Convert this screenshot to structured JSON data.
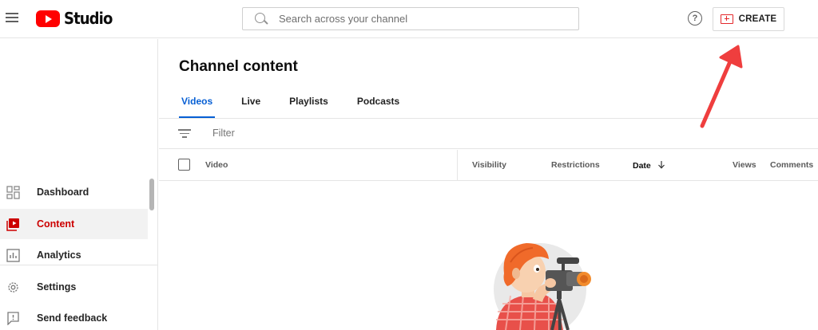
{
  "header": {
    "logo_text": "Studio",
    "search_placeholder": "Search across your channel",
    "create_label": "CREATE",
    "help_glyph": "?"
  },
  "sidebar": {
    "items": [
      {
        "label": "Dashboard",
        "icon": "dashboard-icon"
      },
      {
        "label": "Content",
        "icon": "content-icon",
        "active": true
      },
      {
        "label": "Analytics",
        "icon": "analytics-icon"
      },
      {
        "label": "Settings",
        "icon": "settings-icon"
      },
      {
        "label": "Send feedback",
        "icon": "feedback-icon"
      }
    ]
  },
  "main": {
    "title": "Channel content",
    "tabs": [
      {
        "label": "Videos",
        "active": true
      },
      {
        "label": "Live"
      },
      {
        "label": "Playlists"
      },
      {
        "label": "Podcasts"
      }
    ],
    "filter_placeholder": "Filter",
    "columns": {
      "video": "Video",
      "visibility": "Visibility",
      "restrictions": "Restrictions",
      "date": "Date",
      "views": "Views",
      "comments": "Comments"
    }
  },
  "colors": {
    "accent": "#065fd4",
    "brand_red": "#ff0000",
    "active_red": "#cc0000",
    "annotation_arrow": "#ef3e3e"
  }
}
